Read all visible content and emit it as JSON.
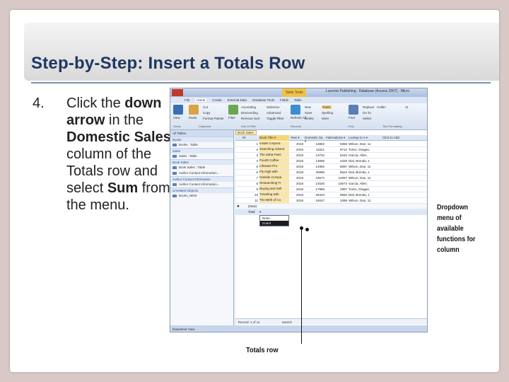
{
  "slide": {
    "title": "Step-by-Step: Insert a Totals Row",
    "step_number": "4.",
    "step_parts": [
      {
        "text": "Click the ",
        "bold": false
      },
      {
        "text": "down arrow",
        "bold": true
      },
      {
        "text": " in the ",
        "bold": false
      },
      {
        "text": "Domestic Sales",
        "bold": true
      },
      {
        "text": " column of the Totals row and select ",
        "bold": false
      },
      {
        "text": "Sum",
        "bold": true
      },
      {
        "text": " from the menu.",
        "bold": false
      }
    ]
  },
  "callouts": {
    "right": "Dropdown menu of available functions for column",
    "bottom": "Totals row"
  },
  "app": {
    "context_tab": "Table Tools",
    "window_title": "Lucerne Publishing : Database (Access 2007) - Micro",
    "ribbon_tabs": [
      "File",
      "Home",
      "Create",
      "External Data",
      "Database Tools",
      "Fields",
      "Table"
    ],
    "ribbon_groups": [
      "Views",
      "Clipboard",
      "Sort & Filter",
      "Records",
      "Find",
      "Text Formatting"
    ],
    "ribbon_buttons": [
      "View",
      "Paste",
      "Cut",
      "Copy",
      "Format Painter",
      "Filter",
      "Ascending",
      "Descending",
      "Remove Sort",
      "Selection",
      "Advanced",
      "Toggle Filter",
      "Refresh All",
      "New",
      "Save",
      "Delete",
      "Totals",
      "Spelling",
      "More",
      "Find",
      "Replace",
      "Go To",
      "Select",
      "Calibri",
      "11"
    ],
    "nav_pane_title": "All Tables",
    "nav": [
      {
        "group": "Books",
        "items": [
          "Books : Table"
        ]
      },
      {
        "group": "Sales",
        "items": [
          "Sales : Table"
        ]
      },
      {
        "group": "Book Sales",
        "items": [
          "Book Sales : Table",
          "Author Contact Information..."
        ]
      },
      {
        "group": "Author Contact Information",
        "items": [
          "Author Contact Information..."
        ]
      },
      {
        "group": "Unrelated Objects",
        "items": [
          "Books_NEW"
        ]
      }
    ],
    "table_tab": "Book Sales",
    "columns": [
      "ID",
      "Book Title",
      "Year",
      "Domestic Sa",
      "Internationa",
      "Lookup to A",
      "Click to Add"
    ],
    "rows": [
      [
        "1",
        "Inside Corpora",
        "2018",
        "13883",
        "9368",
        "Wilson, Dan, 11"
      ],
      [
        "2",
        "Searching Advent",
        "2018",
        "11521",
        "6712",
        "Tomic, Dragan,"
      ],
      [
        "3",
        "The Zaha Fami",
        "2018",
        "13734",
        "5432",
        "Garcia, Allen,"
      ],
      [
        "4",
        "Fourth Coffee",
        "2018",
        "13696",
        "4325",
        "Dial, Brenda, 1"
      ],
      [
        "5",
        "Lifeware Pro",
        "2018",
        "14952",
        "5087",
        "Wilson, Dan, 11"
      ],
      [
        "6",
        "Fly High with",
        "2018",
        "20895",
        "8523",
        "Dial, Brenda, 1"
      ],
      [
        "7",
        "Outside Compa",
        "2018",
        "23674",
        "12097",
        "Wilson, Dan, 11"
      ],
      [
        "8",
        "Researching Tr",
        "2018",
        "14530",
        "10673",
        "Garcia, Allen,"
      ],
      [
        "9",
        "Buying and Sell",
        "2018",
        "17985",
        "2987",
        "Tomic, Dragan,"
      ],
      [
        "10",
        "Traveling with",
        "2018",
        "25423",
        "9650",
        "Dial, Brenda, 1"
      ],
      [
        "11",
        "The Birth of Co",
        "2018",
        "16047",
        "1098",
        "Wilson, Dan, 11"
      ]
    ],
    "new_row_label": "(New)",
    "total_row_label": "Total",
    "dropdown_options": [
      "None",
      "Count"
    ],
    "record_nav": "Record: 1 of 11",
    "search_label": "Search",
    "status": "Datasheet View"
  }
}
